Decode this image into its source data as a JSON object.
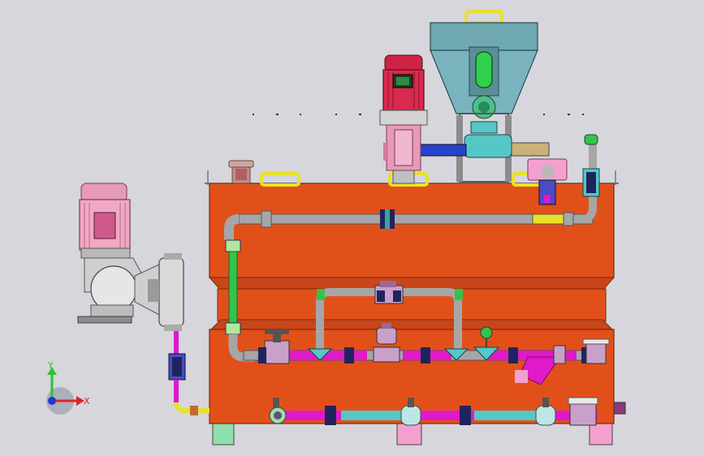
{
  "triad": {
    "x_label": "X",
    "y_label": "Y"
  },
  "colors": {
    "background": "#d6d6dc",
    "tank": "#e2501a",
    "tank_dark": "#b83c10",
    "hopper": "#6fa9b3",
    "motor": "#cf2345",
    "motor_pink": "#e79ab8",
    "pipe_gray": "#a6a6a6",
    "pipe_magenta": "#e019c9",
    "pipe_green": "#35c24a",
    "fitting_teal": "#55c7c7",
    "fitting_yellow": "#e8e12a",
    "coupling_navy": "#20245e",
    "base_green": "#8fe0b0",
    "base_pink": "#f3a0cf",
    "axis_red": "#e02424",
    "axis_green": "#2fbf3a",
    "axis_blue": "#2436d8"
  }
}
